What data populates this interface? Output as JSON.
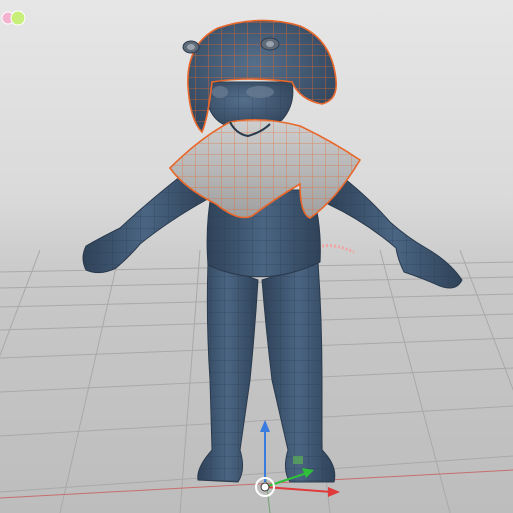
{
  "viewport": {
    "background_top": "#e6e6e6",
    "background_bottom": "#bdbdbd",
    "grid_color": "#a9a9a9",
    "axis_x_color": "#c86e6e",
    "axis_z_color": "#6fa06f"
  },
  "model": {
    "body_color": "#3f5773",
    "wire_color": "#2a3a4d",
    "selection_color": "#e8672a",
    "cape_color": "#bdbdbd",
    "selected_parts": [
      "hood",
      "cape"
    ]
  },
  "gizmo": {
    "icons": [
      "move-gizmo",
      "x-axis-arrow",
      "y-axis-arrow",
      "z-axis-arrow",
      "pivot-icon"
    ],
    "x_color": "#e03a3a",
    "y_color": "#3a7be0",
    "z_color": "#2fbf3a"
  },
  "indicator": {
    "icon": "lights-indicator-icon",
    "colors": [
      "#f3b3d0",
      "#c8ef7a"
    ]
  }
}
